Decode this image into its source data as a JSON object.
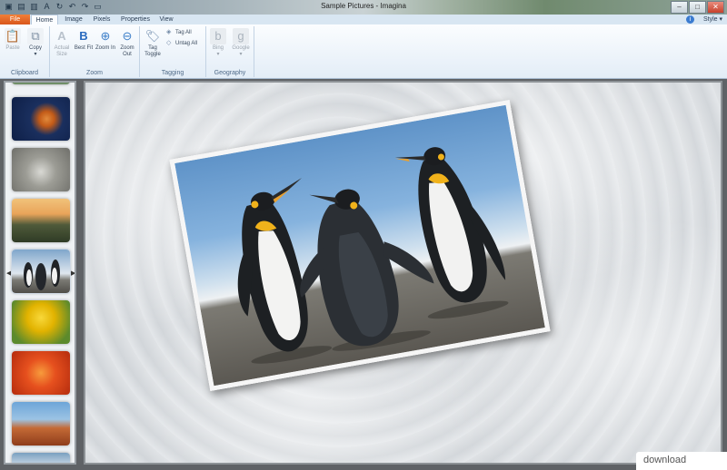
{
  "window": {
    "title": "Sample Pictures - Imagina"
  },
  "tabs": [
    "File",
    "Home",
    "Image",
    "Pixels",
    "Properties",
    "View"
  ],
  "style_menu": "Style",
  "ribbon": {
    "clipboard": {
      "label": "Clipboard",
      "paste": "Paste",
      "copy": "Copy"
    },
    "zoom": {
      "label": "Zoom",
      "actual_size": "Actual Size",
      "best_fit": "Best Fit",
      "zoom_in": "Zoom In",
      "zoom_out": "Zoom Out"
    },
    "tagging": {
      "label": "Tagging",
      "tag_toggle": "Tag Toggle",
      "tag_all": "Tag All",
      "untag_all": "Untag All"
    },
    "geography": {
      "label": "Geography",
      "bing": "Bing",
      "google": "Google"
    }
  },
  "thumbnails": [
    {
      "subject": "jellyfish",
      "color": "#c35b18"
    },
    {
      "subject": "koala",
      "color": "#8b8b85"
    },
    {
      "subject": "lighthouse",
      "color": "#b5793d"
    },
    {
      "subject": "penguins",
      "color": "#6f8eaa",
      "selected": true
    },
    {
      "subject": "tulips",
      "color": "#e2b300"
    },
    {
      "subject": "chrysanthemum",
      "color": "#d53d12"
    },
    {
      "subject": "desert",
      "color": "#b0562a"
    }
  ],
  "watermark": "download"
}
